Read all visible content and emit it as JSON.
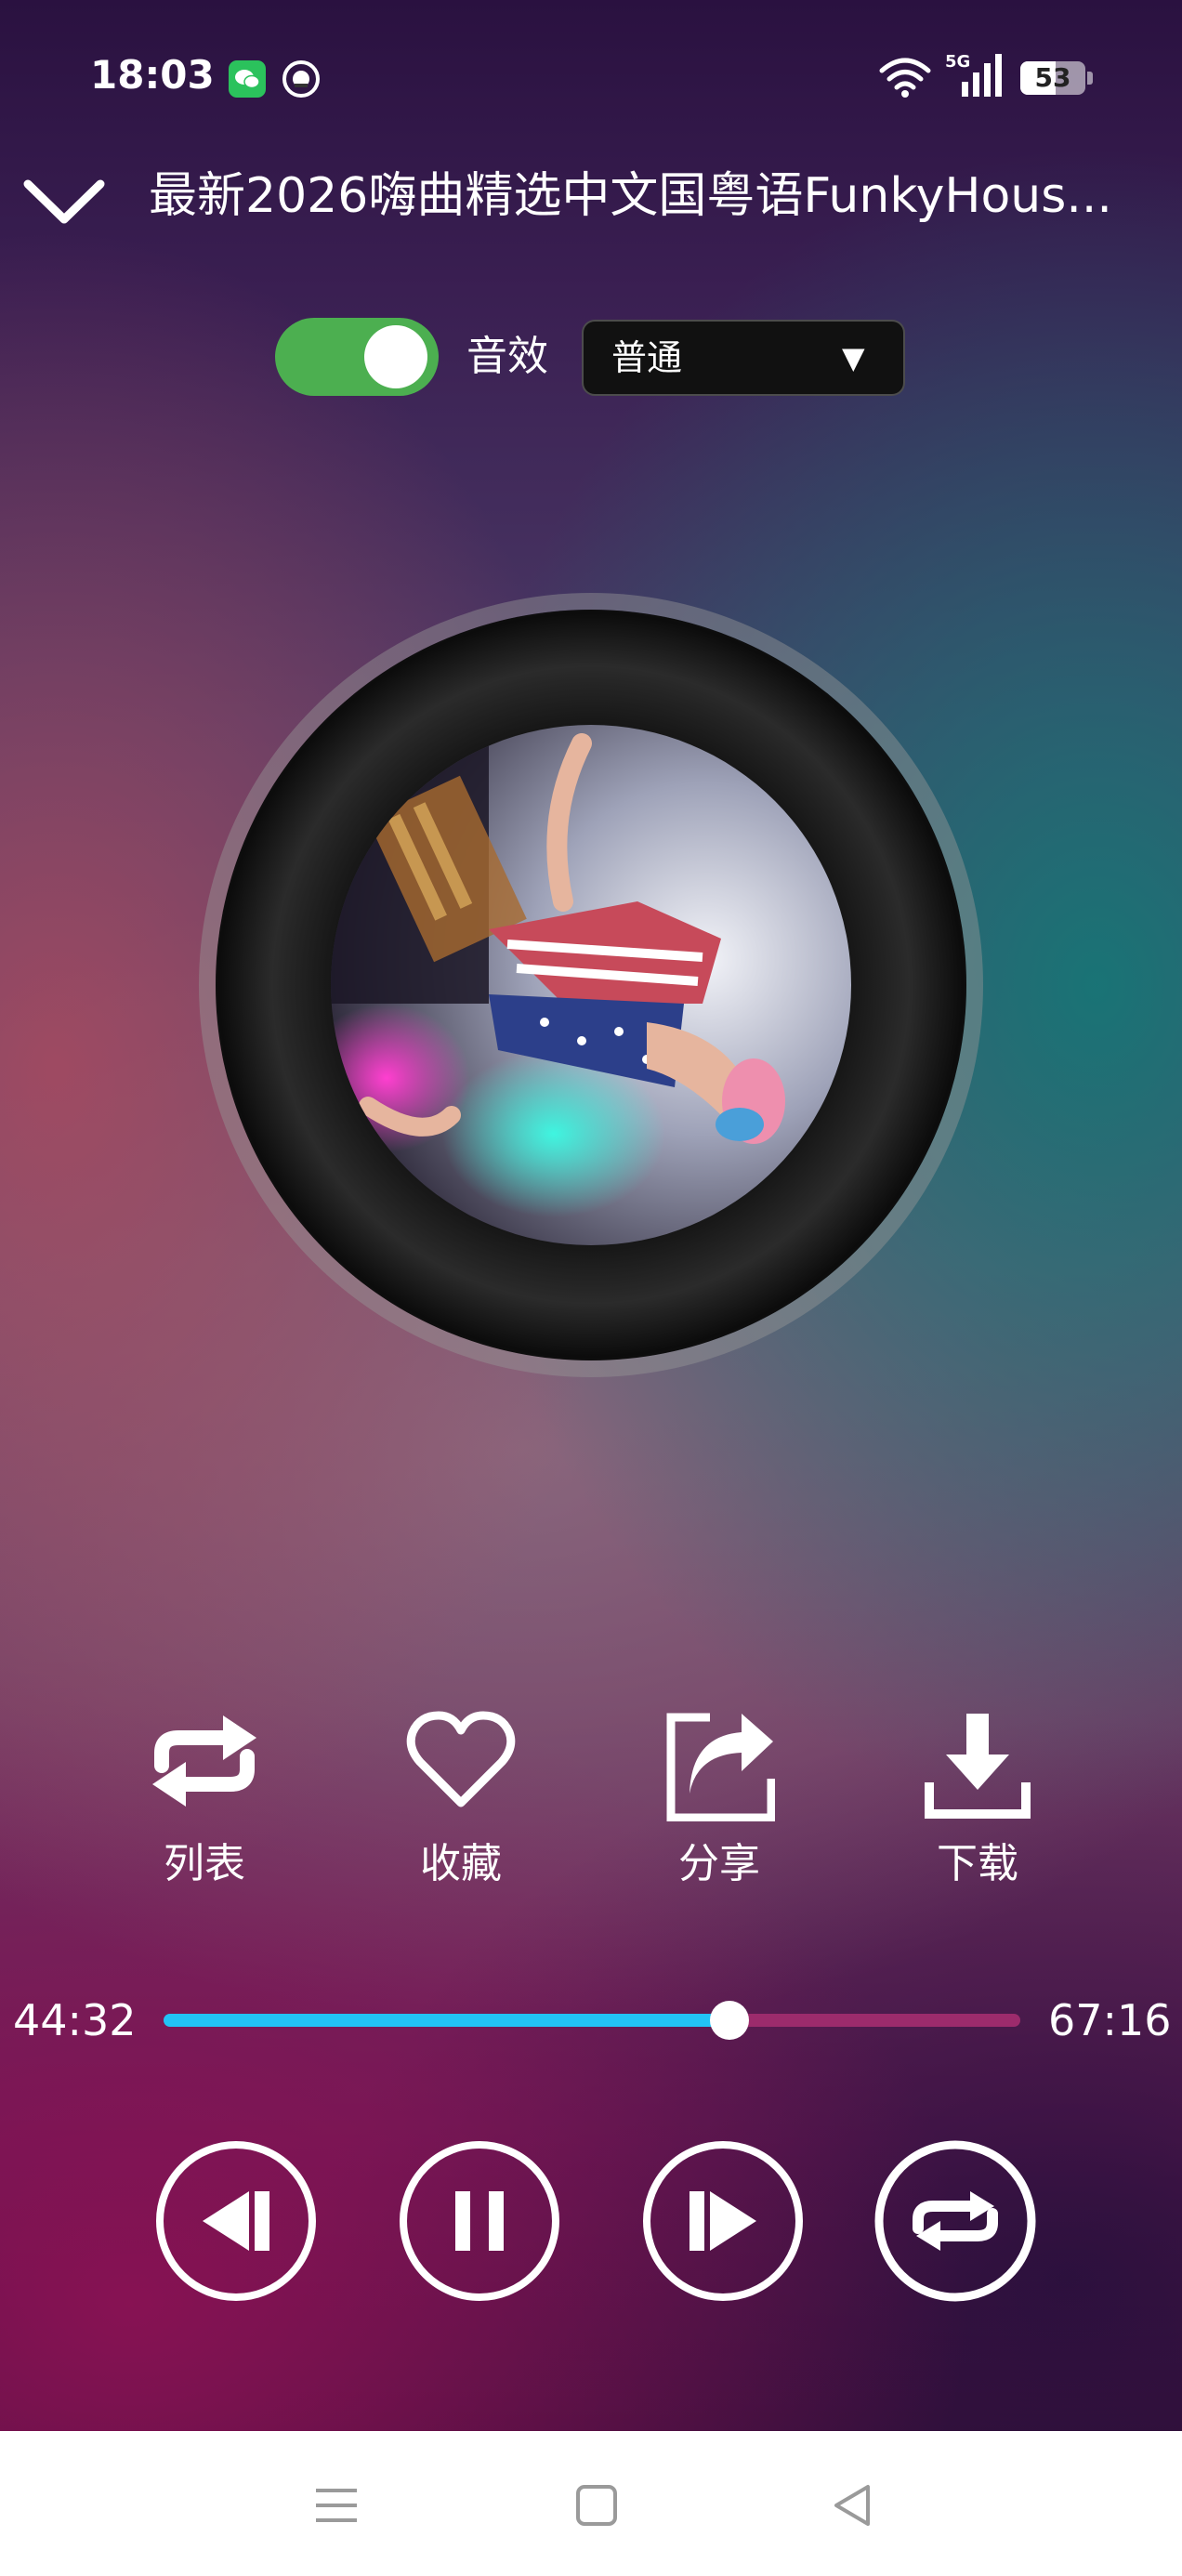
{
  "status_bar": {
    "time": "18:03",
    "network": "5G",
    "battery": "53",
    "notification_icons": [
      "wechat-icon",
      "music-notification-icon"
    ],
    "system_icons": [
      "wifi-icon",
      "signal-icon",
      "battery-icon"
    ]
  },
  "header": {
    "title": "最新2026嗨曲精选中文国粤语FunkyHous...",
    "collapse_icon": "chevron-down-icon"
  },
  "effects": {
    "enabled": true,
    "label": "音效",
    "preset": "普通",
    "dropdown_icon": "▼"
  },
  "actions": [
    {
      "label": "列表",
      "icon": "repeat-list-icon"
    },
    {
      "label": "收藏",
      "icon": "heart-icon"
    },
    {
      "label": "分享",
      "icon": "share-icon"
    },
    {
      "label": "下载",
      "icon": "download-icon"
    }
  ],
  "progress": {
    "current": "44:32",
    "total": "67:16",
    "fraction": 0.66
  },
  "controls": [
    "previous-icon",
    "pause-icon",
    "next-icon",
    "repeat-icon"
  ],
  "nav_bar": [
    "menu-icon",
    "home-icon",
    "back-icon"
  ],
  "colors": {
    "toggle_on": "#4caf50",
    "progress_played": "#22c3f5",
    "progress_remaining": "#9c2b6c",
    "wechat_green": "#2bc25c"
  }
}
